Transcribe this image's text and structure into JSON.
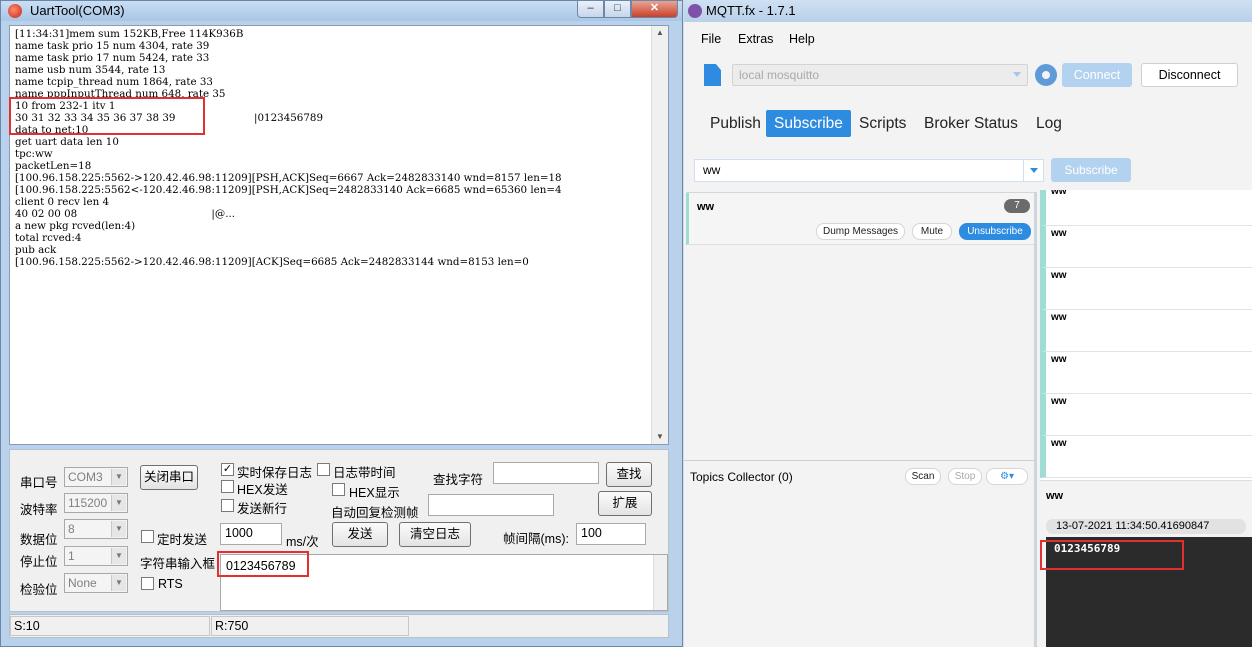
{
  "uart": {
    "title": "UartTool(COM3)",
    "window_min": "–",
    "window_max": "□",
    "window_close": "✕",
    "console_text": "[11:34:31]mem sum 152KB,Free 114K936B\nname task prio 15 num 4304, rate 39\nname task prio 17 num 5424, rate 33\nname usb num 3544, rate 13\nname tcpip_thread num 1864, rate 33\nname pppInputThread num 648, rate 35\n10 from 232-1 itv 1\n30 31 32 33 34 35 36 37 38 39                        |0123456789\ndata to net:10\nget uart data len 10\ntpc:ww\npacketLen=18\n[100.96.158.225:5562->120.42.46.98:11209][PSH,ACK]Seq=6667 Ack=2482833140 wnd=8157 len=18\n[100.96.158.225:5562<-120.42.46.98:11209][PSH,ACK]Seq=2482833140 Ack=6685 wnd=65360 len=4\nclient 0 recv len 4\n40 02 00 08                                         |@...\na new pkg rcved(len:4)\ntotal rcved:4\npub ack\n[100.96.158.225:5562->120.42.46.98:11209][ACK]Seq=6685 Ack=2482833144 wnd=8153 len=0",
    "port_label": "串口号",
    "port_value": "COM3",
    "baud_label": "波特率",
    "baud_value": "115200",
    "databits_label": "数据位",
    "databits_value": "8",
    "stopbits_label": "停止位",
    "stopbits_value": "1",
    "parity_label": "检验位",
    "parity_value": "None",
    "close_port_btn": "关闭串口",
    "realtime_log": "实时保存日志",
    "log_with_time": "日志带时间",
    "hex_send": "HEX发送",
    "hex_show": "HEX显示",
    "send_newline": "发送新行",
    "auto_reply": "自动回复检测帧",
    "find_label": "查找字符",
    "find_btn": "查找",
    "expand_btn": "扩展",
    "timed_send": "定时发送",
    "interval_value": "1000",
    "interval_unit": "ms/次",
    "send_btn": "发送",
    "clear_btn": "清空日志",
    "frame_interval_label": "帧间隔(ms):",
    "frame_interval_value": "100",
    "string_input_label": "字符串输入框",
    "rts": "RTS",
    "string_input_value": "0123456789",
    "status_sent": "S:10",
    "status_received": "R:750"
  },
  "mqtt": {
    "title": "MQTT.fx - 1.7.1",
    "menu": [
      "File",
      "Extras",
      "Help"
    ],
    "broker_profile": "local mosquitto",
    "connect_btn": "Connect",
    "disconnect_btn": "Disconnect",
    "tabs": [
      "Publish",
      "Subscribe",
      "Scripts",
      "Broker Status",
      "Log"
    ],
    "active_tab": "Subscribe",
    "topic_input": "ww",
    "subscribe_btn": "Subscribe",
    "subscription": {
      "topic": "ww",
      "count": "7",
      "dump_btn": "Dump Messages",
      "mute_btn": "Mute",
      "unsubscribe_btn": "Unsubscribe"
    },
    "topics_collector": "Topics Collector (0)",
    "scan_btn": "Scan",
    "stop_btn": "Stop",
    "settings_btn": "⚙▾",
    "messages": [
      "ww",
      "ww",
      "ww",
      "ww",
      "ww",
      "ww",
      "ww"
    ],
    "detail_topic": "ww",
    "detail_timestamp": "13-07-2021  11:34:50.41690847",
    "detail_payload": "0123456789",
    "accent_color": "#2e8ce0"
  }
}
